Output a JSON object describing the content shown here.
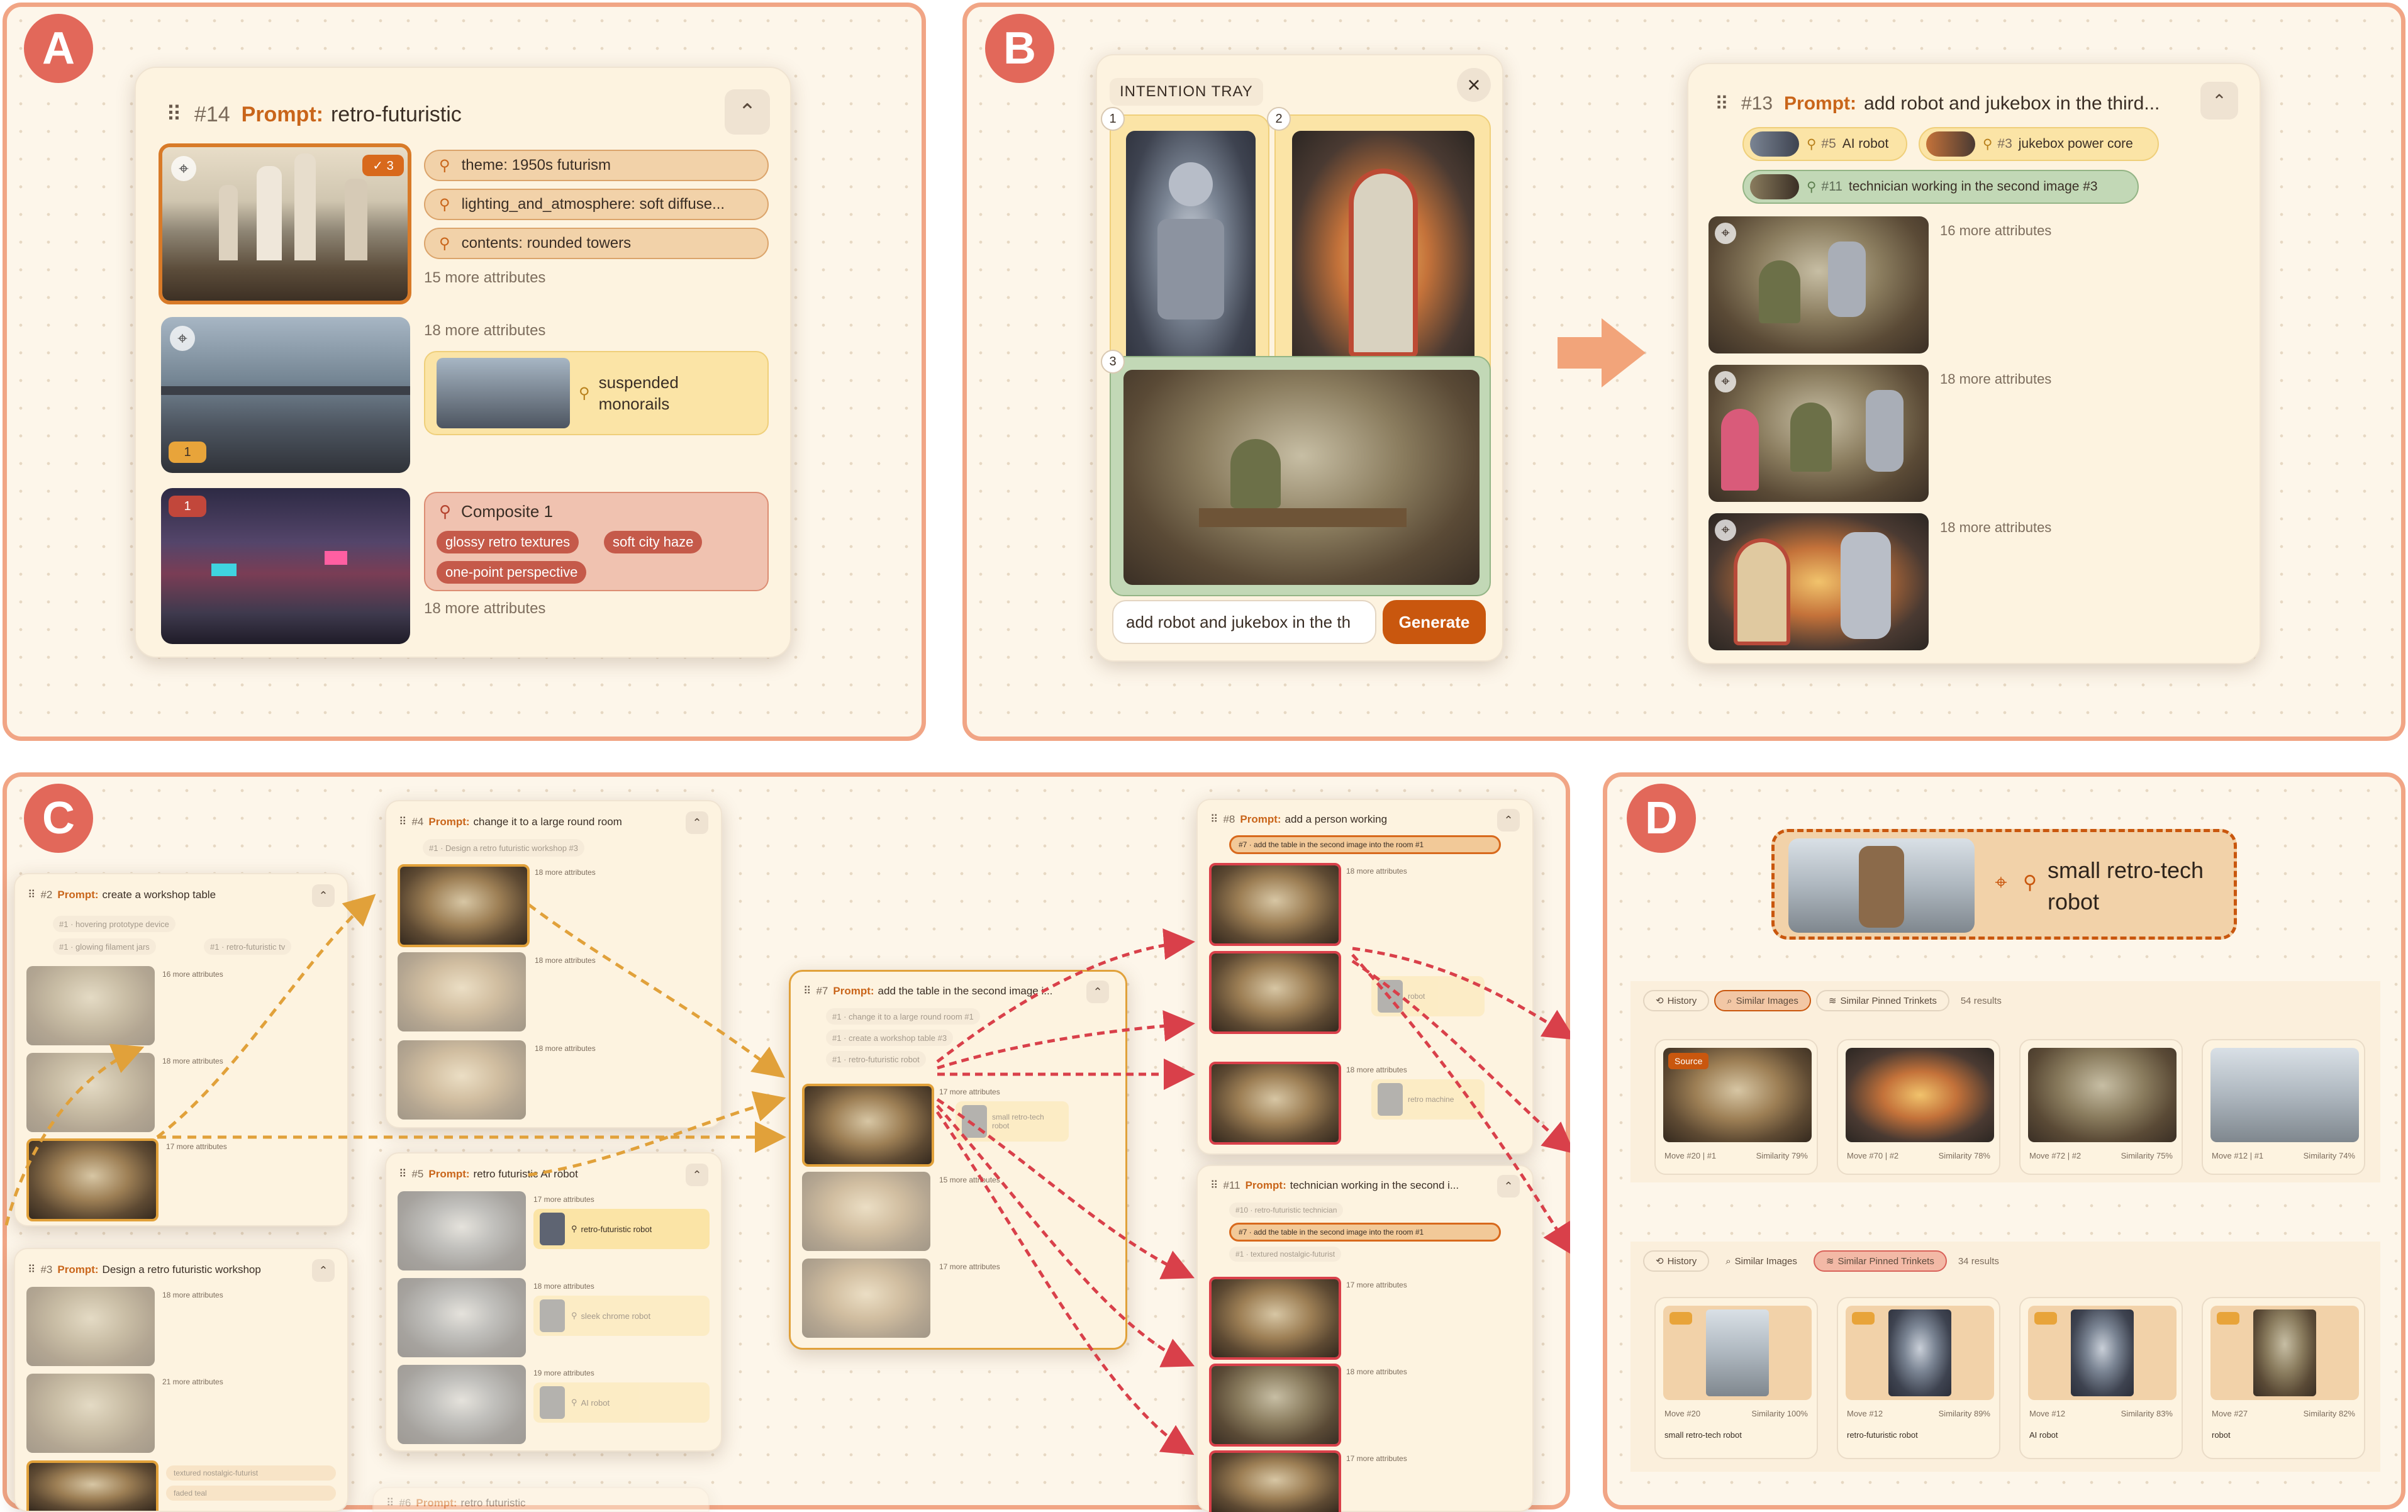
{
  "labels": {
    "a": "A",
    "b": "B",
    "c": "C",
    "d": "D"
  },
  "colors": {
    "panel_border": "#f1a585",
    "accent": "#c9570e",
    "prompt": "#c9651a",
    "pin_theme": "#f2d2a9",
    "pin_subject": "#fbe4a6",
    "composite": "#f0c2b0",
    "tray_green": "#c2d8b6",
    "arrow_orange": "#e1a13a",
    "arrow_red": "#d9404a"
  },
  "common": {
    "prompt_kw": "Prompt:",
    "grip": "⠿",
    "collapse": "⌃",
    "crosshair": "⌖",
    "pin": "⚲",
    "attrs_15": "15 more attributes",
    "attrs_16": "16 more attributes",
    "attrs_17": "17 more attributes",
    "attrs_18": "18 more attributes",
    "attrs_19": "19 more attributes",
    "attrs_21": "21 more attributes"
  },
  "panel_a": {
    "num": "#14",
    "prompt": "retro-futuristic",
    "img1_badge": "✓ 3",
    "img2_badge": "1",
    "img3_badge": "1",
    "pills": [
      "theme: 1950s futurism",
      "lighting_and_atmosphere: soft diffuse...",
      "contents: rounded towers"
    ],
    "img1_more": "15 more attributes",
    "img2_more": "18 more attributes",
    "img3_more": "18 more attributes",
    "subject_pin": "suspended monorails",
    "composite_title": "Composite 1",
    "composite_tags": [
      "glossy retro textures",
      "soft city haze",
      "one-point perspective"
    ]
  },
  "panel_b": {
    "tray_title": "INTENTION TRAY",
    "close": "×",
    "tray_nums": [
      "1",
      "2",
      "3"
    ],
    "input_value": "add robot and jukebox in the th",
    "generate": "Generate",
    "card_num": "#13",
    "card_prompt": "add robot and jukebox in the third...",
    "chips": [
      {
        "num": "#5",
        "label": "AI robot"
      },
      {
        "num": "#3",
        "label": "jukebox power core"
      },
      {
        "num": "#11",
        "label": "technician working in the second image #3"
      }
    ],
    "more": [
      "16 more attributes",
      "18 more attributes",
      "18 more attributes"
    ]
  },
  "panel_c": {
    "n2": {
      "num": "#2",
      "prompt": "create a workshop table",
      "chips": [
        "#1 · hovering prototype device",
        "#1 · glowing filament jars",
        "#1 · retro-futuristic tv"
      ],
      "more": [
        "16 more attributes",
        "18 more attributes",
        "17 more attributes"
      ]
    },
    "n3": {
      "num": "#3",
      "prompt": "Design a retro futuristic workshop",
      "more": [
        "18 more attributes",
        "21 more attributes"
      ],
      "chips": [
        "textured nostalgic-futurist",
        "faded teal"
      ]
    },
    "n4": {
      "num": "#4",
      "prompt": "change it to a large round room",
      "chip": "#1 · Design a retro futuristic workshop #3",
      "more": [
        "18 more attributes",
        "18 more attributes",
        "18 more attributes"
      ]
    },
    "n5": {
      "num": "#5",
      "prompt": "retro futuristic AI robot",
      "more": [
        "17 more attributes",
        "18 more attributes",
        "19 more attributes"
      ],
      "pins": [
        "retro-futuristic robot",
        "sleek chrome robot",
        "AI robot"
      ]
    },
    "n6": {
      "num": "#6",
      "prompt": "retro futuristic"
    },
    "n7": {
      "num": "#7",
      "prompt": "add the table in the second image i...",
      "chips": [
        "#1 · change it to a large round room #1",
        "#1 · create a workshop table #3",
        "#1 · retro-futuristic robot"
      ],
      "more": [
        "17 more attributes",
        "15 more attributes",
        "17 more attributes"
      ],
      "pin": "small retro-tech robot"
    },
    "n8": {
      "num": "#8",
      "prompt": "add a person working",
      "chip": "#7 · add the table in the second image into the room #1",
      "more": [
        "18 more attributes",
        "18 more attributes",
        "18 more attributes"
      ],
      "pins": [
        "robot",
        "retro machine"
      ]
    },
    "n11": {
      "num": "#11",
      "prompt": "technician working in the second i...",
      "chips": [
        "#10 · retro-futuristic technician",
        "#7 · add the table in the second image into the room #1",
        "#1 · textured nostalgic-futurist"
      ],
      "more": [
        "17 more attributes",
        "18 more attributes",
        "17 more attributes"
      ]
    }
  },
  "panel_d": {
    "pin_label": "small retro-tech robot",
    "tabs1": [
      "History",
      "Similar Images",
      "Similar Pinned Trinkets"
    ],
    "results1": "54 results",
    "tabs2": [
      "History",
      "Similar Images",
      "Similar Pinned Trinkets"
    ],
    "results2": "34 results",
    "source": "Source",
    "row1": [
      {
        "move": "Move #20 | #1",
        "sim": "Similarity 79%"
      },
      {
        "move": "Move #70 | #2",
        "sim": "Similarity 78%"
      },
      {
        "move": "Move #72 | #2",
        "sim": "Similarity 75%"
      },
      {
        "move": "Move #12 | #1",
        "sim": "Similarity 74%"
      }
    ],
    "row2": [
      {
        "move": "Move #20",
        "sim": "Similarity 100%",
        "label": "small retro-tech robot"
      },
      {
        "move": "Move #12",
        "sim": "Similarity 89%",
        "label": "retro-futuristic robot"
      },
      {
        "move": "Move #12",
        "sim": "Similarity 83%",
        "label": "AI robot"
      },
      {
        "move": "Move #27",
        "sim": "Similarity 82%",
        "label": "robot"
      }
    ]
  }
}
